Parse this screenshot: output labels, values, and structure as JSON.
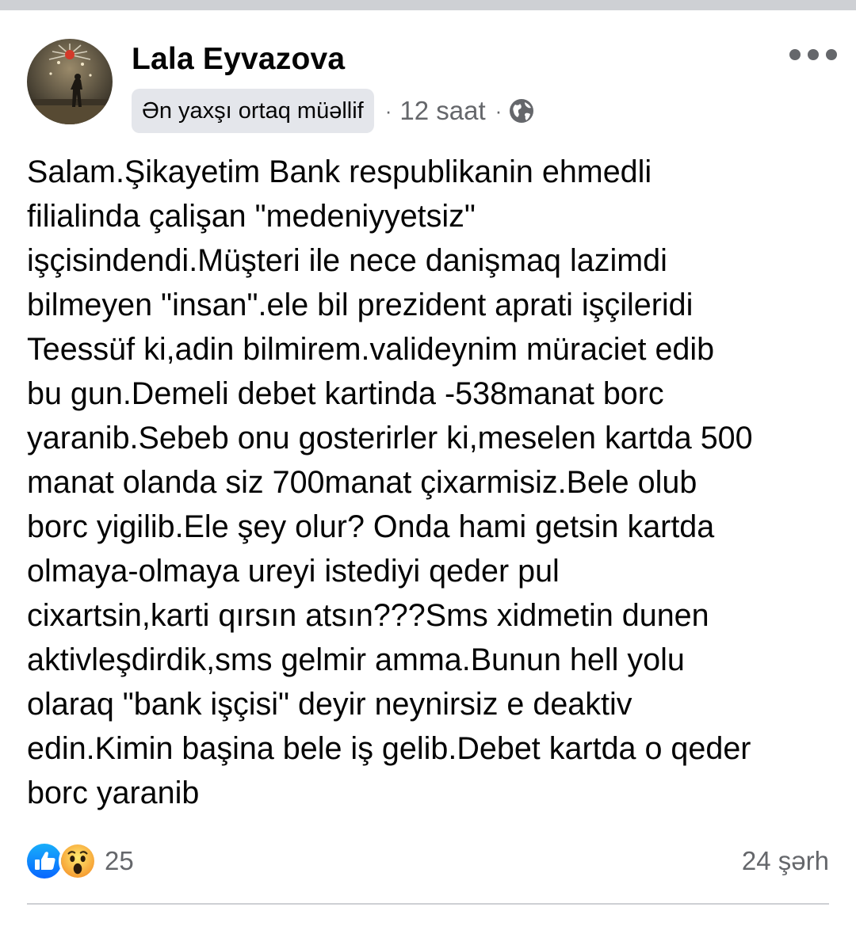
{
  "post": {
    "author": {
      "name": "Lala Eyvazova",
      "avatar_icon": "profile-photo"
    },
    "badge_label": "Ən yaxşı ortaq müəllif",
    "separator": "·",
    "timestamp": "12 saat",
    "audience_icon": "globe-icon",
    "more_icon": "three-dots-icon",
    "body_lines": [
      "Salam.Şikayetim Bank respublikanin ehmedli",
      "filialinda çalişan \"medeniyyetsiz\"",
      "işçisindendi.Müşteri ile nece danişmaq lazimdi",
      "bilmeyen \"insan\".ele bil prezident aprati işçileridi",
      "Teessüf ki,adin bilmirem.valideynim müraciet edib",
      "bu gun.Demeli debet kartinda -538manat borc",
      "yaranib.Sebeb onu gosterirler ki,meselen kartda 500",
      "manat olanda siz 700manat çixarmisiz.Bele olub",
      "borc yigilib.Ele şey olur? Onda hami getsin kartda",
      "olmaya-olmaya ureyi istediyi qeder pul",
      "cixartsin,karti qırsın atsın???Sms xidmetin dunen",
      "aktivleşdirdik,sms gelmir amma.Bunun hell yolu",
      "olaraq \"bank işçisi\" deyir neynirsiz e deaktiv",
      "edin.Kimin başina bele iş gelib.Debet kartda o qeder",
      "borc yaranib"
    ],
    "reactions": {
      "icons": [
        "like-icon",
        "wow-icon"
      ],
      "count": "25"
    },
    "comments_label": "24 şərh"
  },
  "colors": {
    "like_blue": "#1877f2",
    "wow_yellow": "#f7b125",
    "secondary_text": "#65676b",
    "badge_bg": "#e4e6eb"
  }
}
